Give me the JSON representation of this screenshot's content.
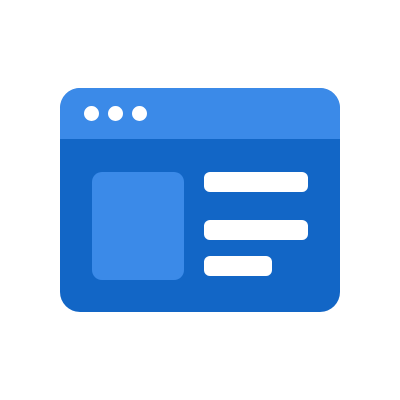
{
  "icon": {
    "name": "browser-window-icon",
    "colors": {
      "frame": "#1266c6",
      "title_bar": "#3b8ae8",
      "image_placeholder": "#3b8ae8",
      "content": "#ffffff",
      "background": "#ffffff"
    },
    "title_bar_dot_count": 3,
    "text_line_count": 3
  }
}
